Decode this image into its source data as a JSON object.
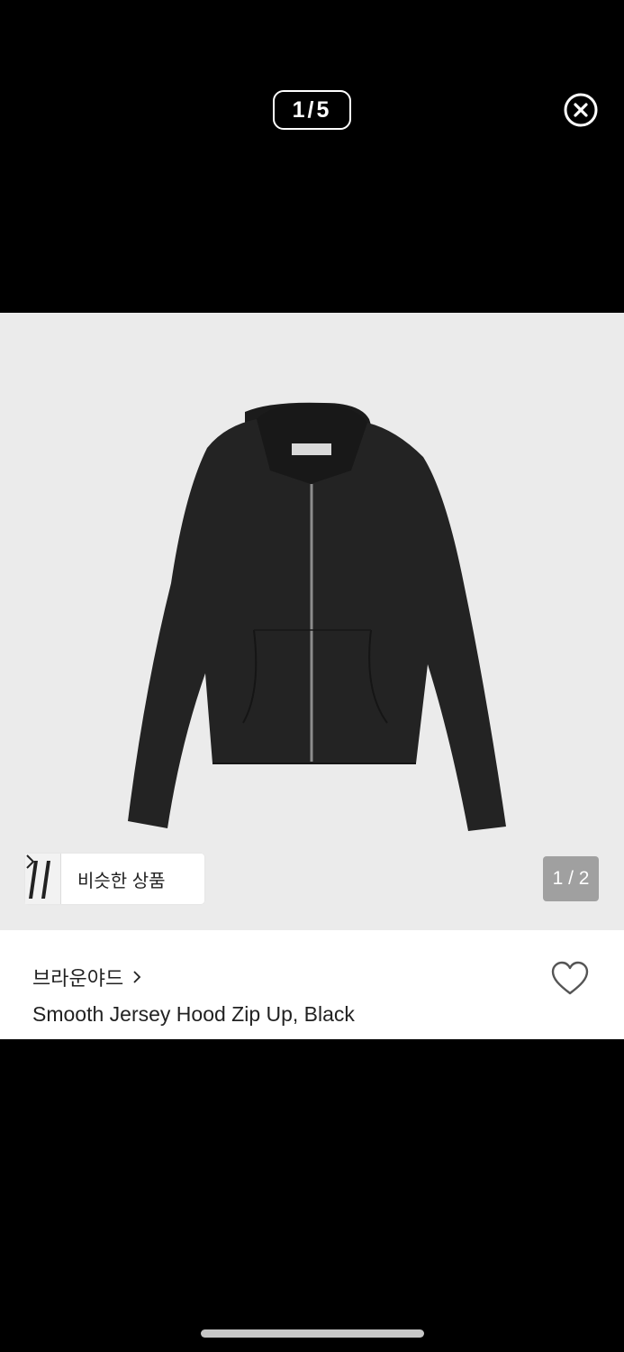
{
  "viewer": {
    "counter": "1/5"
  },
  "close_icon": "close-circle-icon",
  "product": {
    "similar_label": "비슷한 상품",
    "image_counter": "1 / 2",
    "brand": "브라운야드",
    "title": "Smooth Jersey Hood Zip Up, Black"
  },
  "colors": {
    "background": "#000000",
    "image_bg": "#ebebeb",
    "text": "#222222",
    "jacket": "#222222"
  }
}
